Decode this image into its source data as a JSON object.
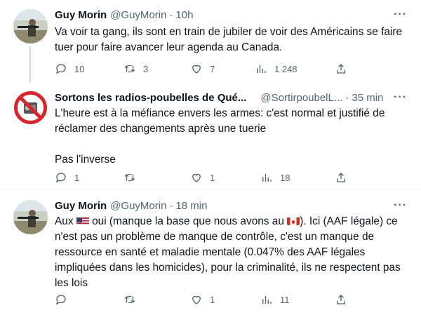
{
  "tweets": [
    {
      "name": "Guy Morin",
      "handle": "@GuyMorin",
      "time": "10h",
      "text": "Va voir ta gang, ils sont en train de jubiler de voir des Américains se faire tuer pour faire avancer leur agenda au Canada.",
      "replies": "10",
      "retweets": "3",
      "likes": "7",
      "views": "1 248"
    },
    {
      "name": "Sortons les radios-poubelles de Qué...",
      "handle": "@SortirpoubelL...",
      "time": "35 min",
      "text_line1": "L'heure est à la méfiance envers les armes: c'est normal et justifié de réclamer des changements après une tuerie",
      "text_line2": "Pas l'inverse",
      "replies": "1",
      "retweets": "",
      "likes": "1",
      "views": "18"
    },
    {
      "name": "Guy Morin",
      "handle": "@GuyMorin",
      "time": "18 min",
      "text_pre": "Aux",
      "text_mid": "oui (manque la base que nous avons au",
      "text_post": "). Ici (AAF légale) ce n'est pas un problème de manque de contrôle, c'est un manque de ressource en santé et maladie mentale (0.047% des AAF légales impliquées dans les homicides), pour la criminalité, ils ne respectent pas les lois",
      "replies": "",
      "retweets": "",
      "likes": "1",
      "views": "11"
    }
  ],
  "separator": "·",
  "more_glyph": "···",
  "icons": [
    "reply-icon",
    "retweet-icon",
    "like-icon",
    "views-icon",
    "share-icon",
    "us-flag-icon",
    "canada-flag-icon"
  ],
  "colors": {
    "text": "#0f1419",
    "secondary": "#536471",
    "thread": "#cfd9de",
    "divider": "#eff3f4"
  }
}
